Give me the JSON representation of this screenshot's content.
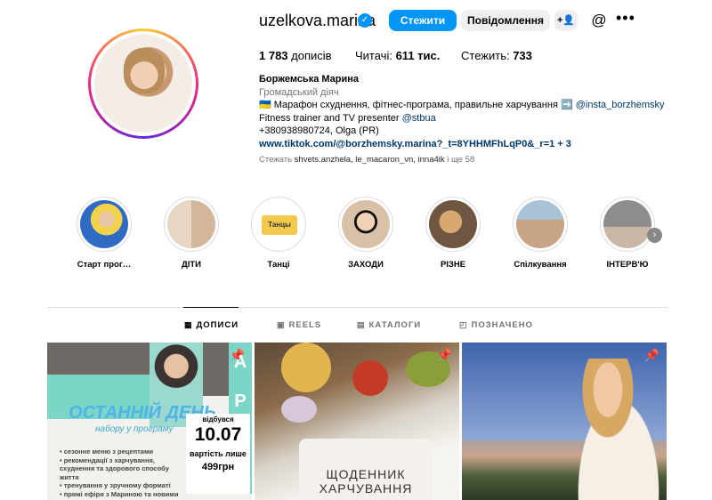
{
  "profile": {
    "username": "uzelkova.marina",
    "follow_label": "Стежити",
    "message_label": "Повідомлення",
    "stats": {
      "posts_count": "1 783",
      "posts_label": "дописів",
      "followers_label": "Читачі:",
      "followers_count": "611 тис.",
      "following_label": "Стежить:",
      "following_count": "733"
    },
    "bio": {
      "name": "Боржемська Марина",
      "category": "Громадський діяч",
      "line1_text": "🇺🇦 Марафон схуднення, фітнес-програма, правильне харчування ➡️ ",
      "line1_mention": "@insta_borzhemsky",
      "line2_text": "Fitness trainer and TV presenter ",
      "line2_mention": "@stbua",
      "line3": "+380938980724, Olga (PR)",
      "link": "www.tiktok.com/@borzhemsky.marina?_t=8YHHMFhLqP0&_r=1 + 3"
    },
    "mutual": {
      "prefix": "Стежать",
      "names": "shvets.anzhela, le_macaron_vn, inna4ik",
      "suffix": "і ще 58"
    }
  },
  "highlights": [
    {
      "label": "Старт прог…",
      "color": "#2f6bc4"
    },
    {
      "label": "ДІТИ",
      "color": "#d9c3b0"
    },
    {
      "label": "Танці",
      "color": "#f2c94c"
    },
    {
      "label": "ЗАХОДИ",
      "color": "#c9a27d"
    },
    {
      "label": "РІЗНЕ",
      "color": "#8c6a4f"
    },
    {
      "label": "Спілкування",
      "color": "#9ab4c9"
    },
    {
      "label": "ІНТЕРВ'Ю",
      "color": "#8d8d8d"
    }
  ],
  "highlight_badge": "Танцы",
  "tabs": [
    {
      "label": "ДОПИСИ",
      "icon": "grid-icon"
    },
    {
      "label": "REELS",
      "icon": "reels-icon"
    },
    {
      "label": "КАТАЛОГИ",
      "icon": "catalog-icon"
    },
    {
      "label": "ПОЗНАЧЕНО",
      "icon": "tagged-icon"
    }
  ],
  "posts": [
    {
      "art_letters": "А\nР\nТ",
      "title": "ОСТАННІЙ ДЕНЬ",
      "subtitle": "набору у програму",
      "list": "• сезонне меню з рецептами\n• рекомендації з харчування, схуднення та здорового способу життя\n• тренування у зручному форматі\n• прямі ефіри з Мариною та новими",
      "card_top": "відбувся",
      "card_date": "10.07",
      "card_price_label": "вартість лише",
      "card_price": "499грн"
    },
    {
      "title": "ЩОДЕННИК ХАРЧУВАННЯ"
    },
    {}
  ]
}
